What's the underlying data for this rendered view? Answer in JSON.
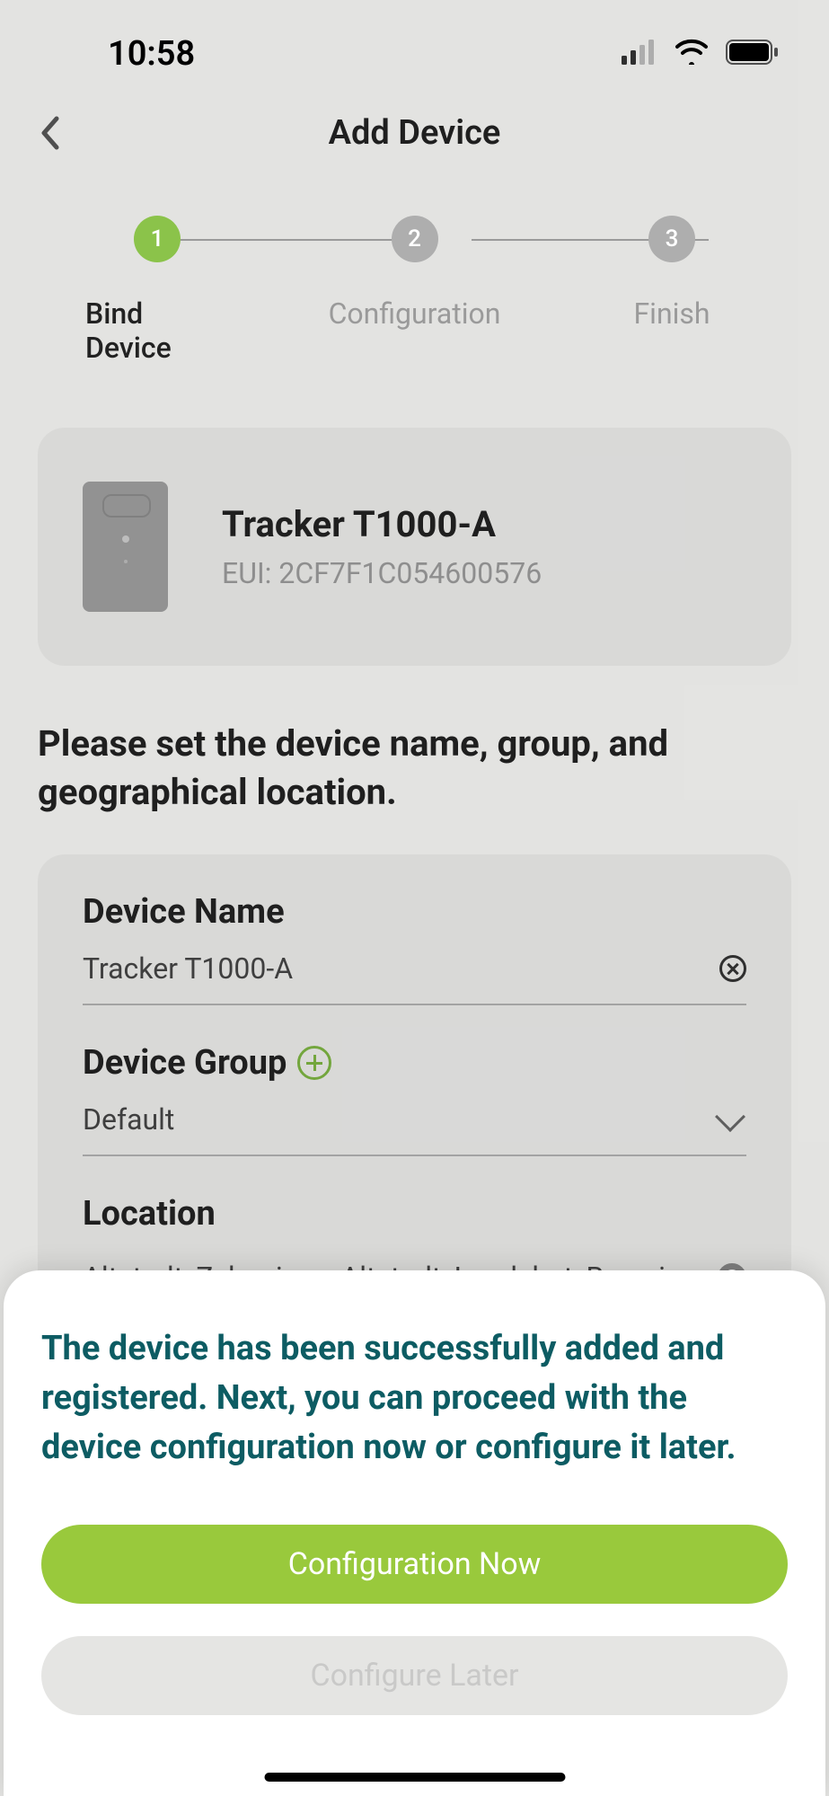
{
  "status_bar": {
    "time": "10:58"
  },
  "header": {
    "title": "Add Device"
  },
  "stepper": {
    "steps": [
      {
        "num": "1",
        "label": "Bind Device"
      },
      {
        "num": "2",
        "label": "Configuration"
      },
      {
        "num": "3",
        "label": "Finish"
      }
    ]
  },
  "device": {
    "name": "Tracker T1000-A",
    "eui_label": "EUI: 2CF7F1C054600576"
  },
  "prompt": "Please set the device name, group, and geographical location.",
  "form": {
    "device_name": {
      "label": "Device Name",
      "value": "Tracker T1000-A"
    },
    "device_group": {
      "label": "Device Group",
      "value": "Default"
    },
    "location": {
      "label": "Location",
      "value": "Altstadt, Zehrwiese, Altstadt, Landshut, Bavaria,"
    }
  },
  "modal": {
    "text": "The device has been successfully added and registered. Next, you can proceed with the device configuration now or configure it later.",
    "primary_btn": "Configuration Now",
    "secondary_btn": "Configure Later"
  }
}
